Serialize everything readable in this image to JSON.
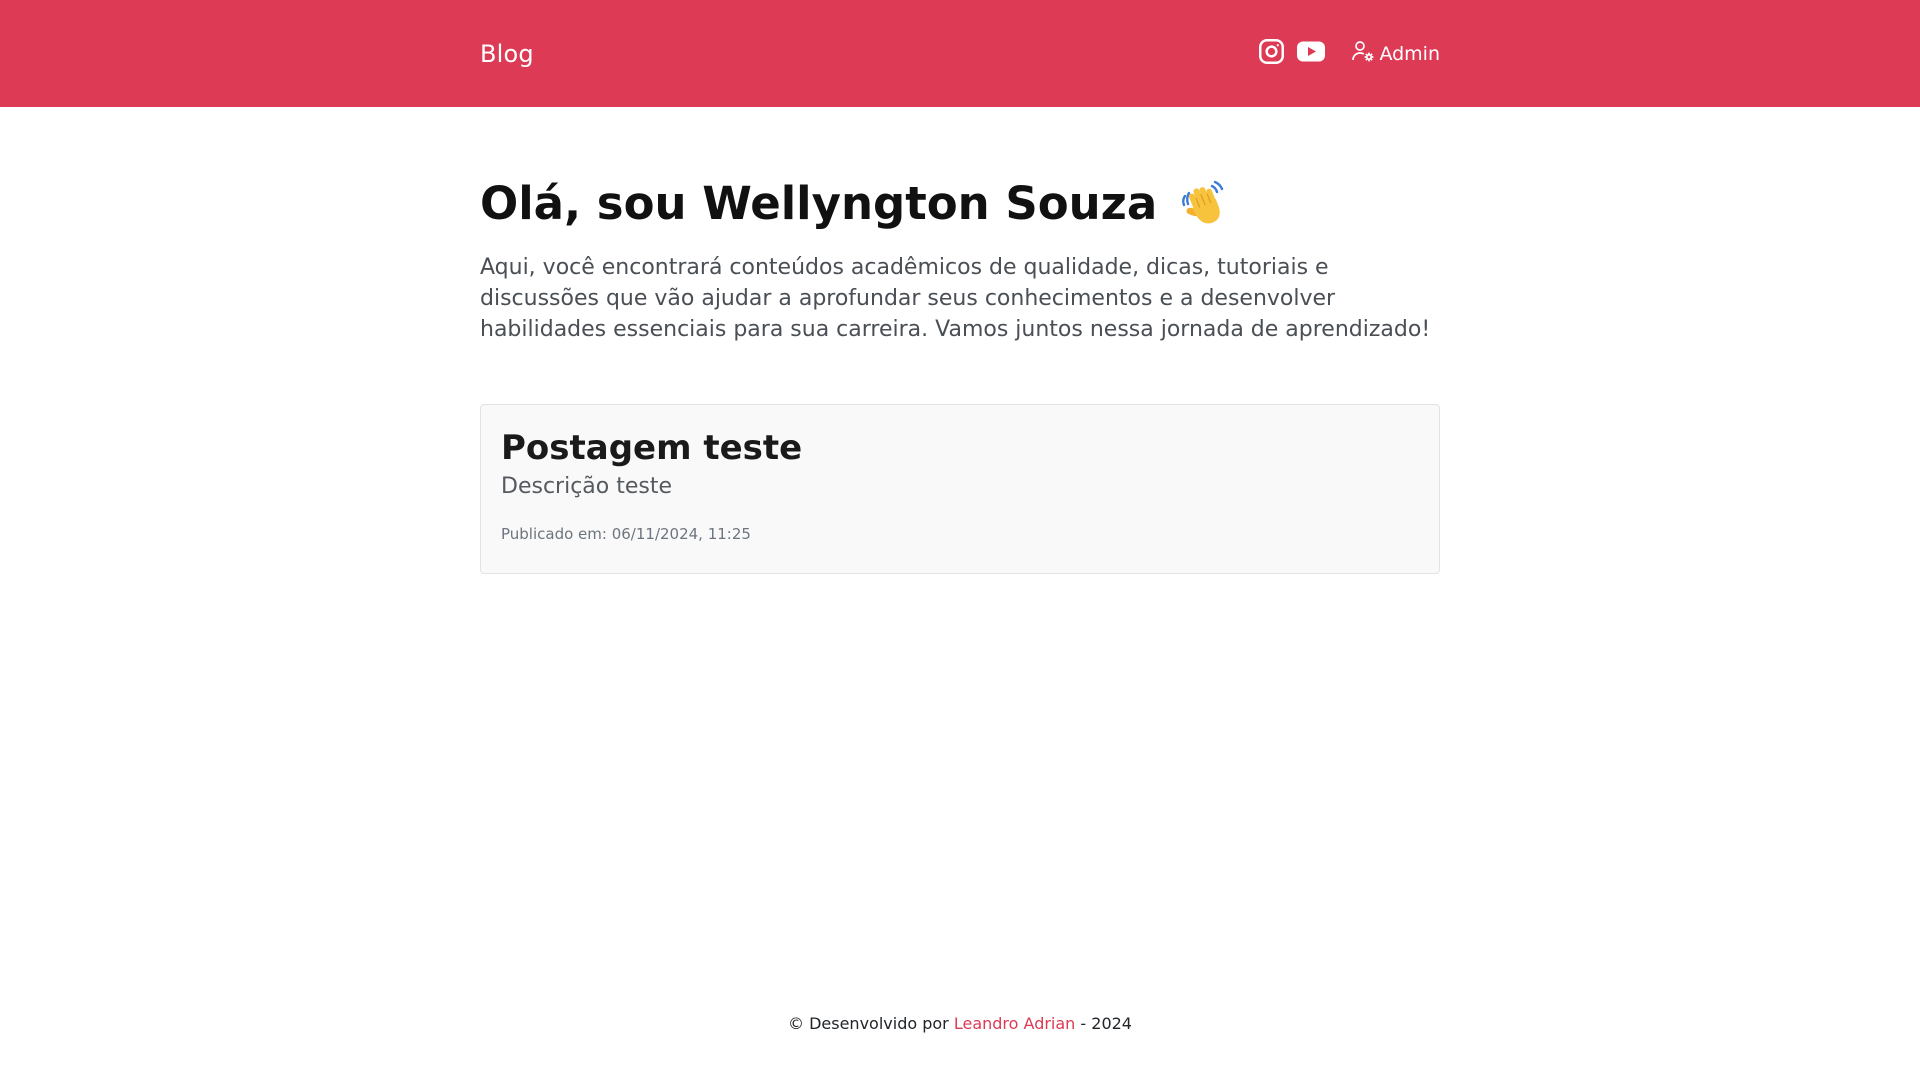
{
  "navbar": {
    "brand": "Blog",
    "admin_label": "Admin",
    "icons": [
      "instagram-icon",
      "youtube-icon",
      "user-gear-icon"
    ],
    "background": "#dc3a55"
  },
  "hero": {
    "title": "Olá, sou Wellyngton Souza",
    "emoji": "waving-hand-icon",
    "text": "Aqui, você encontrará conteúdos acadêmicos de qualidade, dicas, tutoriais e discussões que vão ajudar a aprofundar seus conhecimentos e a desenvolver habilidades essenciais para sua carreira. Vamos juntos nessa jornada de aprendizado!"
  },
  "posts": [
    {
      "title": "Postagem teste",
      "description": "Descrição teste",
      "published": "Publicado em: 06/11/2024, 11:25"
    }
  ],
  "footer": {
    "prefix": "© Desenvolvido por",
    "author": "Leandro Adrian",
    "suffix": "- 2024",
    "link_color": "#dc3a55"
  }
}
